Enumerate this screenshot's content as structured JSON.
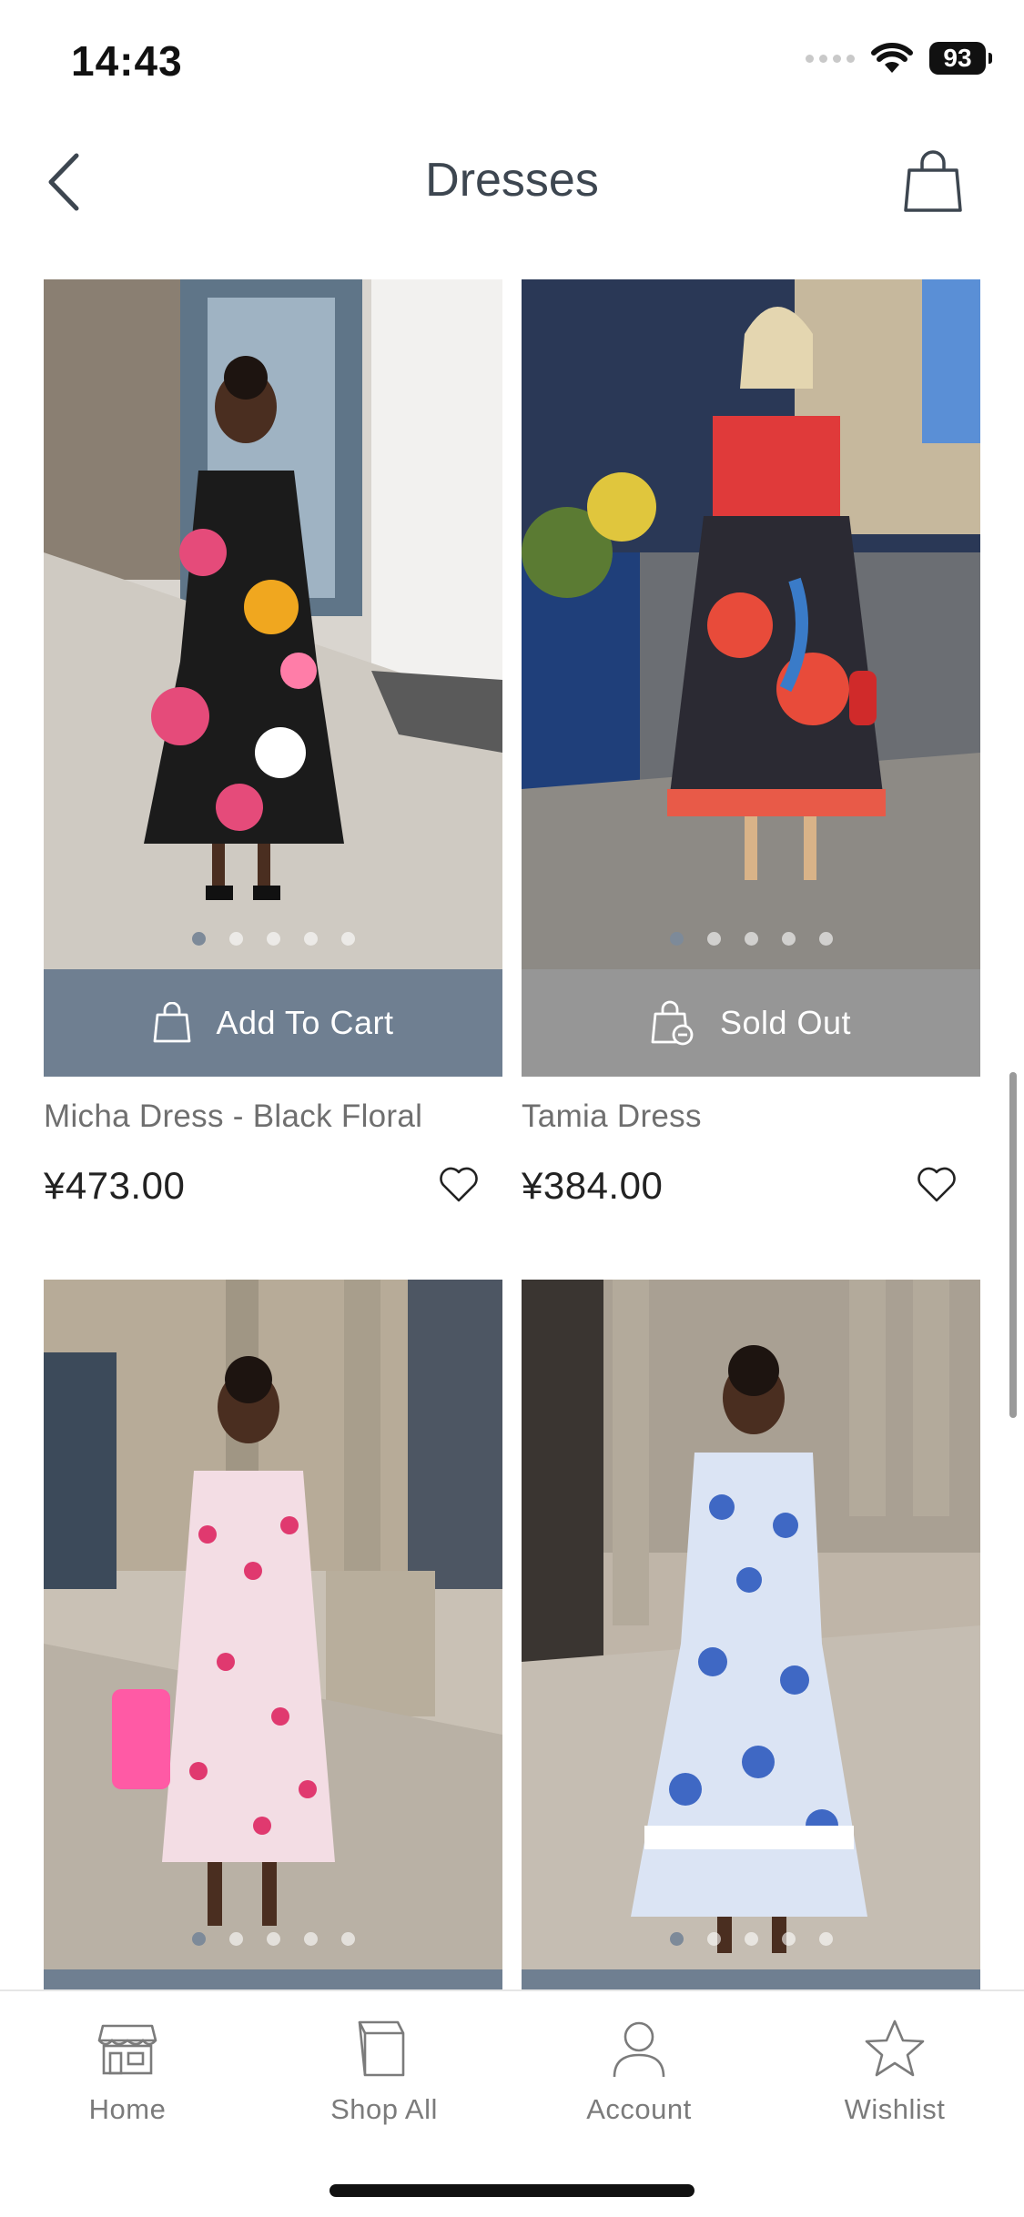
{
  "status_bar": {
    "time": "14:43",
    "battery": "93",
    "icons": [
      "signal-icon",
      "wifi-icon",
      "battery-icon"
    ]
  },
  "header": {
    "title": "Dresses",
    "back_icon": "chevron-left-icon",
    "cart_icon": "shopping-bag-icon"
  },
  "products": [
    {
      "name": "Micha Dress - Black Floral",
      "price": "¥473.00",
      "action": "Add To Cart",
      "action_state": "available",
      "image_dots": 5,
      "active_dot": 0,
      "palette": {
        "bg": "#d8d3cc",
        "wall": "#f1f0ee",
        "dress": "#1b1b1b",
        "accent": "#e54b7a",
        "accent2": "#f0a71f"
      }
    },
    {
      "name": "Tamia Dress",
      "price": "¥384.00",
      "action": "Sold Out",
      "action_state": "sold-out",
      "image_dots": 5,
      "active_dot": 0,
      "palette": {
        "bg": "#4a4a52",
        "wall": "#23314f",
        "dress": "#2b2a33",
        "accent": "#e84b3a",
        "accent2": "#3a7bc8"
      }
    },
    {
      "name": "",
      "price": "",
      "action": "",
      "action_state": "available",
      "image_dots": 5,
      "active_dot": 0,
      "palette": {
        "bg": "#c7bfb3",
        "wall": "#a59c8e",
        "dress": "#f3dde4",
        "accent": "#e0396f",
        "accent2": "#ff5aa5"
      }
    },
    {
      "name": "",
      "price": "",
      "action": "",
      "action_state": "available",
      "image_dots": 5,
      "active_dot": 0,
      "palette": {
        "bg": "#bdb3a6",
        "wall": "#9d948a",
        "dress": "#dbe4f4",
        "accent": "#3f68c4",
        "accent2": "#ffffff"
      }
    }
  ],
  "tabbar": {
    "tabs": [
      {
        "label": "Home",
        "icon": "store-icon"
      },
      {
        "label": "Shop All",
        "icon": "shopping-bag-icon"
      },
      {
        "label": "Account",
        "icon": "user-icon"
      },
      {
        "label": "Wishlist",
        "icon": "star-icon"
      }
    ]
  },
  "colors": {
    "add_to_cart_bg": "#6f7f91",
    "sold_out_bg": "#969696",
    "active_dot": "#7d8a99"
  }
}
